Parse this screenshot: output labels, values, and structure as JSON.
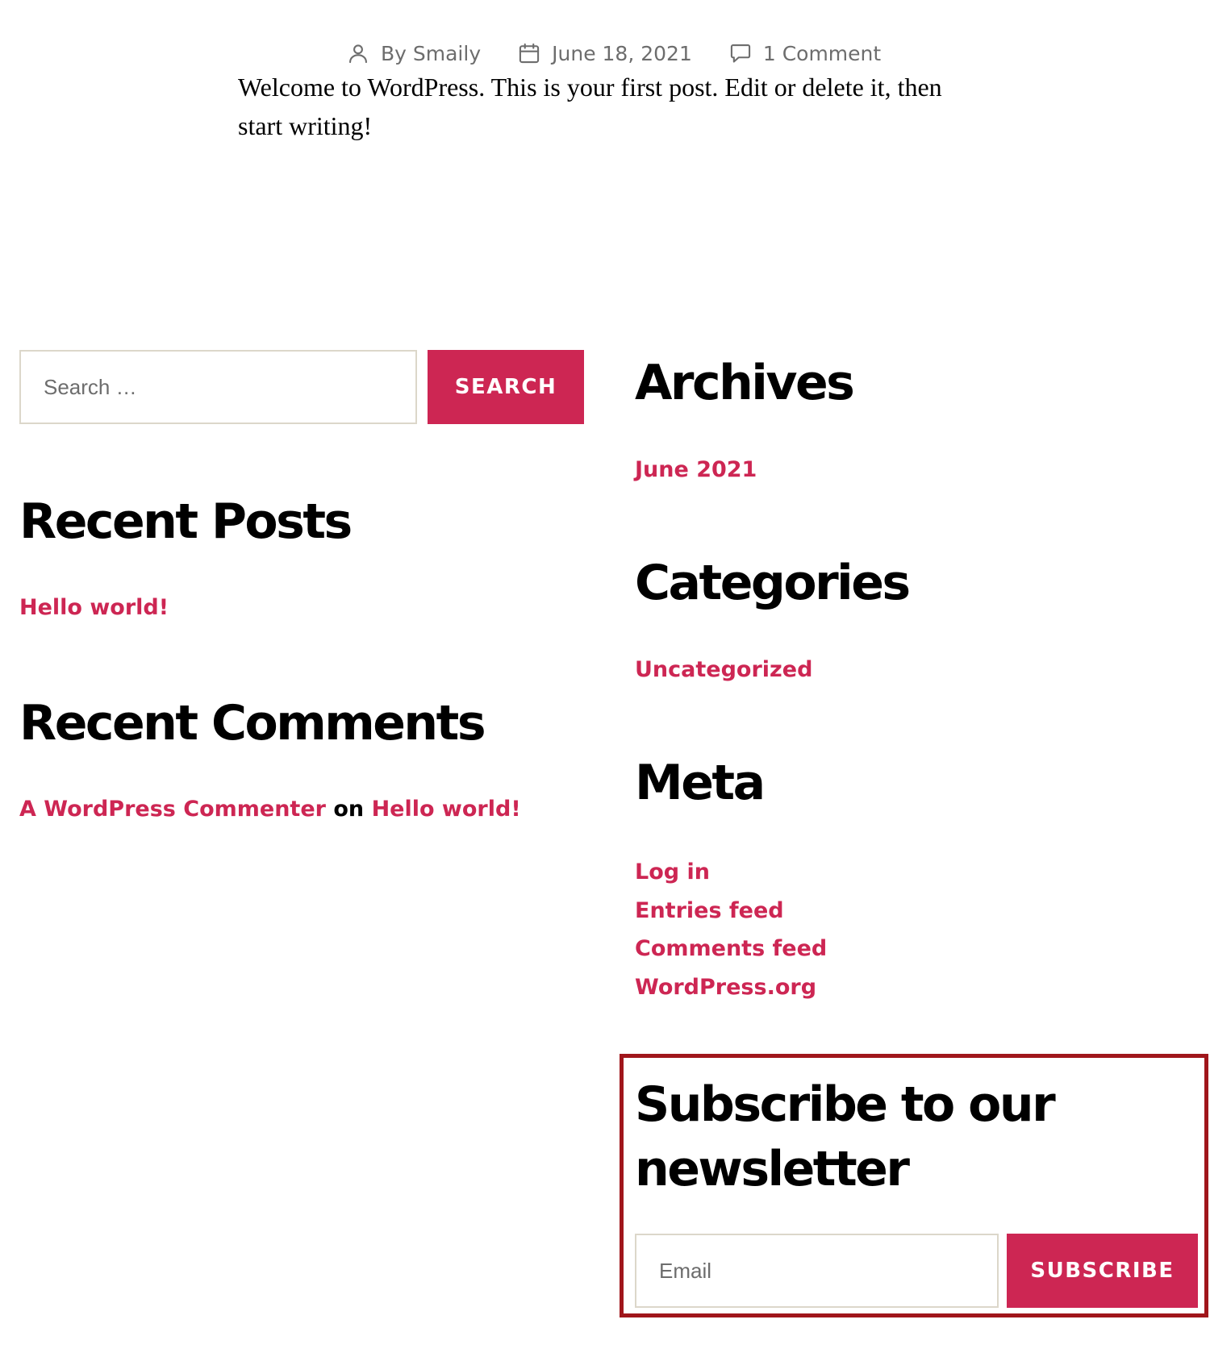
{
  "colors": {
    "accent": "#cd2653",
    "meta_text": "#6d6d6d",
    "highlight_border": "#a0161b",
    "input_border": "#dcd7ca"
  },
  "post": {
    "meta": {
      "author": "By Smaily",
      "author_icon": "person-icon",
      "date": "June 18, 2021",
      "date_icon": "calendar-icon",
      "comments": "1 Comment",
      "comments_icon": "comment-bubble-icon"
    },
    "content": "Welcome to WordPress. This is your first post. Edit or delete it, then start writing!"
  },
  "search": {
    "placeholder": "Search …",
    "value": "",
    "button_label": "SEARCH"
  },
  "recent_posts": {
    "title": "Recent Posts",
    "items": [
      {
        "label": "Hello world!"
      }
    ]
  },
  "recent_comments": {
    "title": "Recent Comments",
    "items": [
      {
        "author": "A WordPress Commenter",
        "connector": "on",
        "post": "Hello world!"
      }
    ]
  },
  "archives": {
    "title": "Archives",
    "items": [
      {
        "label": "June 2021"
      }
    ]
  },
  "categories": {
    "title": "Categories",
    "items": [
      {
        "label": "Uncategorized"
      }
    ]
  },
  "meta_widget": {
    "title": "Meta",
    "items": [
      {
        "label": "Log in"
      },
      {
        "label": "Entries feed"
      },
      {
        "label": "Comments feed"
      },
      {
        "label": "WordPress.org"
      }
    ]
  },
  "newsletter": {
    "title": "Subscribe to our newsletter",
    "email_placeholder": "Email",
    "email_value": "",
    "button_label": "SUBSCRIBE"
  }
}
